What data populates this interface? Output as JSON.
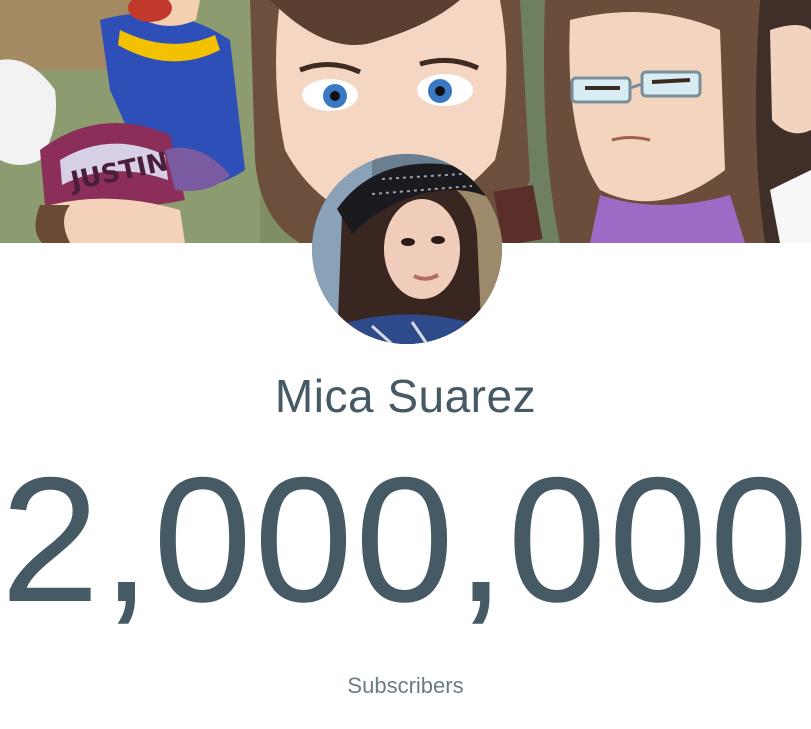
{
  "channel": {
    "name": "Mica Suarez",
    "subscriber_count": "2,000,000",
    "subscriber_label": "Subscribers"
  },
  "banner": {
    "hat_text": "JUSTIN",
    "image": "cartoon-characters-banner"
  },
  "avatar": {
    "image": "profile-photo-girl-in-black-hat"
  },
  "colors": {
    "text": "#455a64",
    "label": "#6b7c85",
    "background": "#ffffff"
  }
}
